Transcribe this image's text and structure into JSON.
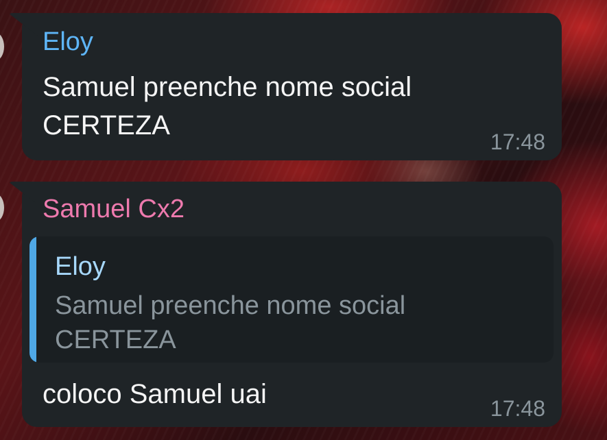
{
  "messages": [
    {
      "sender": "Eloy",
      "text": "Samuel preenche nome social CERTEZA",
      "time": "17:48"
    },
    {
      "sender": "Samuel Cx2",
      "reply": {
        "sender": "Eloy",
        "text": "Samuel preenche nome social CERTEZA"
      },
      "text": "coloco Samuel uai",
      "time": "17:48"
    }
  ],
  "colors": {
    "bubble_bg": "#1f2427",
    "sender_eloy": "#5eb5f7",
    "sender_samuel": "#ee7aae",
    "reply_bar": "#4fa8e6",
    "time_text": "#8a959c"
  }
}
